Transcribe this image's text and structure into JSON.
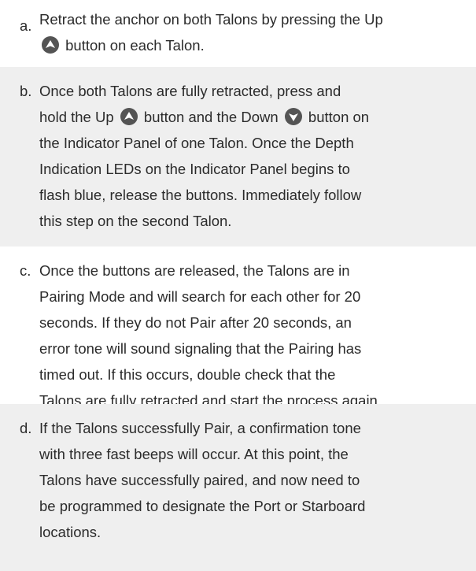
{
  "steps": [
    {
      "letter": "a.",
      "lines": [
        [
          "Retract the anchor on both Talons by pressing the Up"
        ],
        [
          "",
          "up",
          " button on each Talon."
        ]
      ]
    },
    {
      "letter": "b.",
      "lines": [
        [
          "Once both Talons are fully retracted, press and"
        ],
        [
          "hold the Up ",
          "up",
          " button and the Down ",
          "down",
          " button on"
        ],
        [
          "the Indicator Panel of one Talon. Once the Depth"
        ],
        [
          "Indication LEDs on the Indicator Panel begins to"
        ],
        [
          "flash blue, release the buttons. Immediately follow"
        ],
        [
          "this step on the second Talon."
        ]
      ]
    },
    {
      "letter": "c.",
      "lines": [
        [
          "Once the buttons are released, the Talons are in"
        ],
        [
          "Pairing Mode and will search for each other for 20"
        ],
        [
          "seconds. If they do not Pair after 20 seconds, an"
        ],
        [
          "error tone will sound signaling that the Pairing has"
        ],
        [
          "timed out. If this occurs, double check that the"
        ],
        [
          "Talons are fully retracted and start the process again."
        ]
      ]
    },
    {
      "letter": "d.",
      "lines": [
        [
          "If the Talons successfully Pair, a confirmation tone"
        ],
        [
          "with three fast beeps will occur. At this point, the"
        ],
        [
          "Talons have successfully paired, and now need to"
        ],
        [
          "be programmed to designate the Port or Starboard"
        ],
        [
          "locations."
        ]
      ]
    }
  ]
}
